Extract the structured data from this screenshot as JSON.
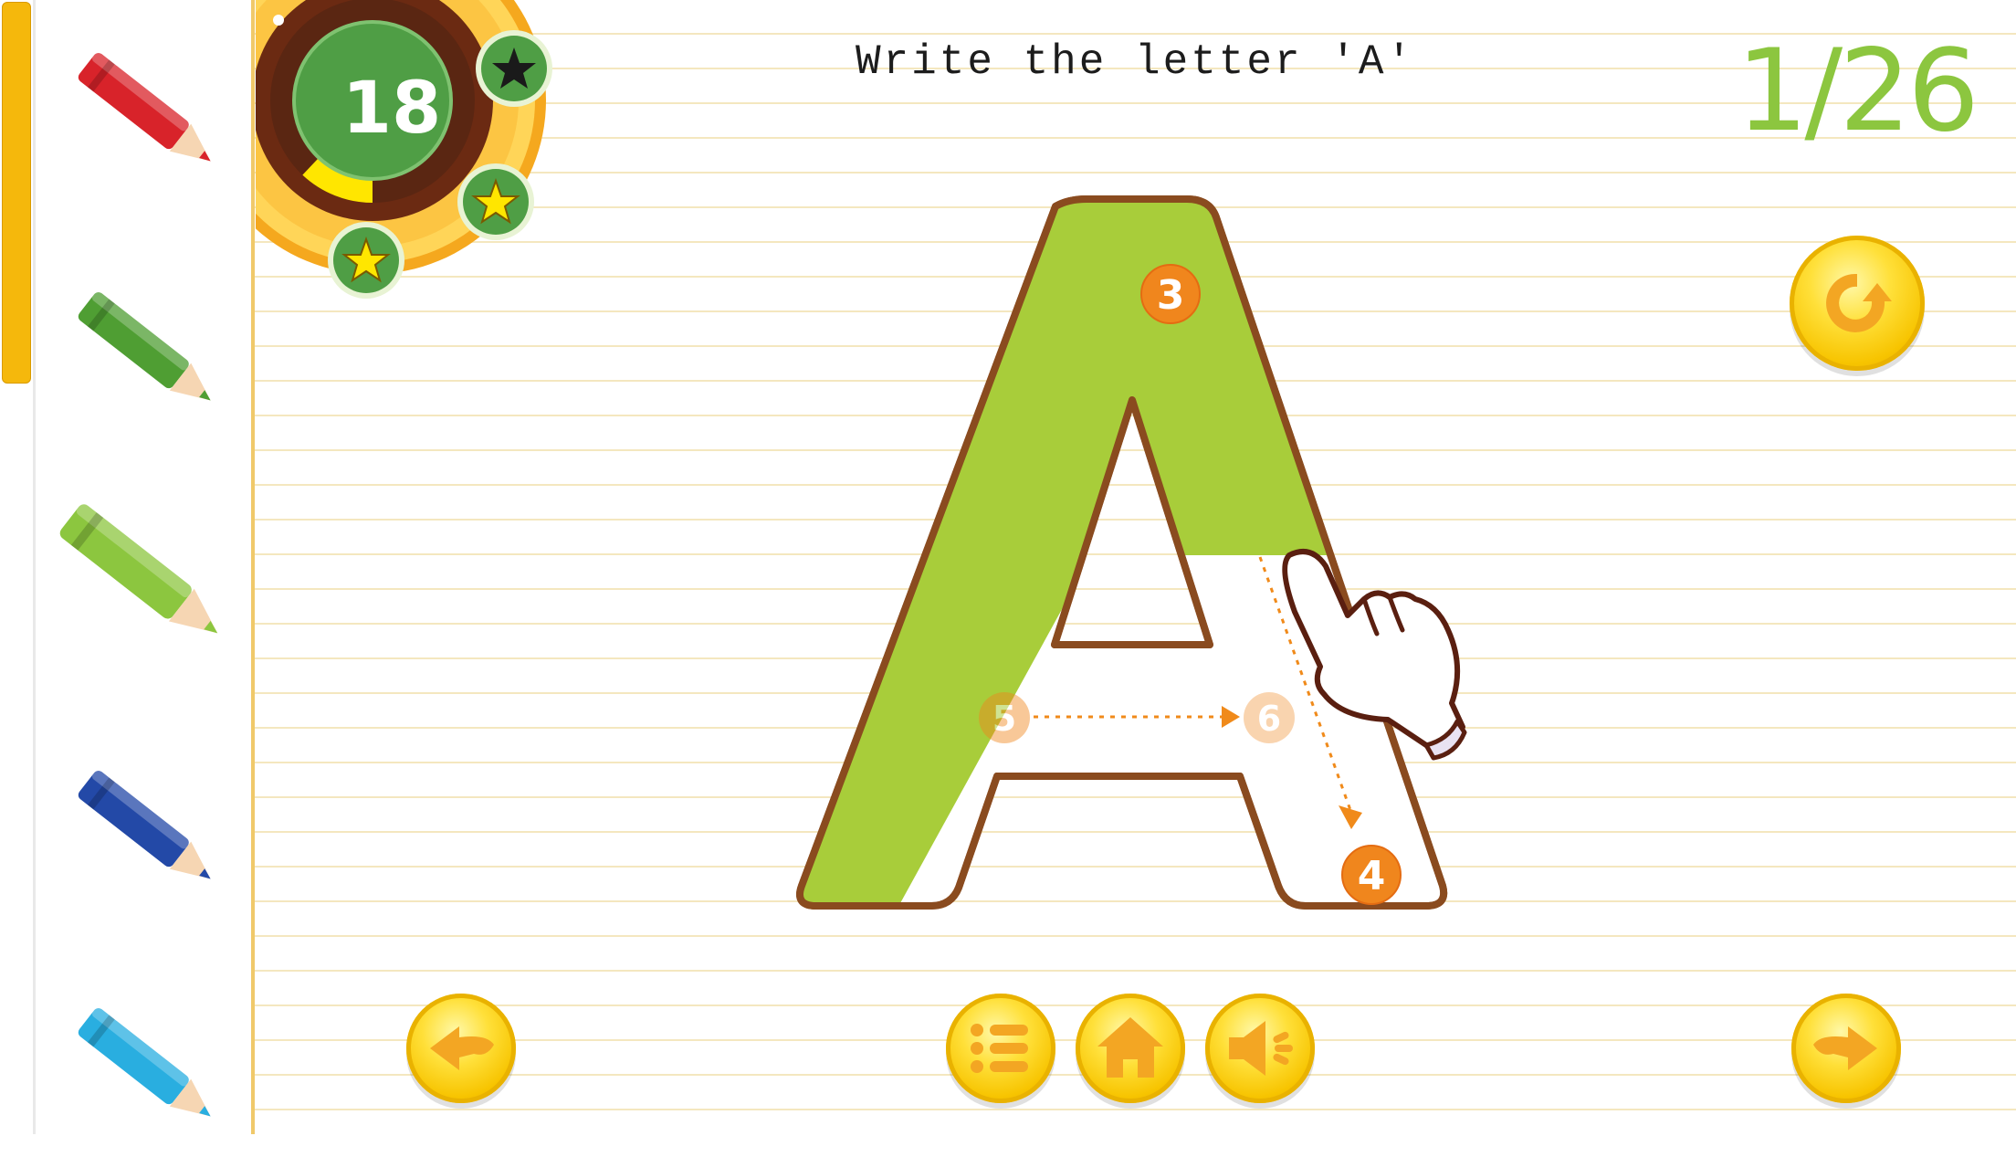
{
  "game": {
    "instruction": "Write the letter 'A'",
    "progress": "1/26",
    "timer": "18",
    "timer_fill_fraction": 0.12,
    "stars_earned": 2,
    "stars_total": 3
  },
  "letter": {
    "character": "A",
    "stroke_numbers": [
      "3",
      "4",
      "5",
      "6"
    ],
    "fill_color": "#a8cd3a",
    "outline_color": "#8a4b1f"
  },
  "palette": {
    "pencils": [
      {
        "name": "red",
        "color": "#d8232a",
        "selected": false
      },
      {
        "name": "green",
        "color": "#4f9e33",
        "selected": false
      },
      {
        "name": "light-green",
        "color": "#8cc63f",
        "selected": true
      },
      {
        "name": "blue",
        "color": "#2349a7",
        "selected": false
      },
      {
        "name": "cyan",
        "color": "#29aee0",
        "selected": false
      }
    ]
  },
  "controls": {
    "refresh": "refresh-icon",
    "previous": "arrow-left-icon",
    "menu": "list-icon",
    "home": "home-icon",
    "sound": "speaker-icon",
    "next": "arrow-right-icon"
  },
  "colors": {
    "accent_yellow": "#f5b80c",
    "progress_green": "#8cc63f",
    "line_color": "#f4e7bf"
  }
}
